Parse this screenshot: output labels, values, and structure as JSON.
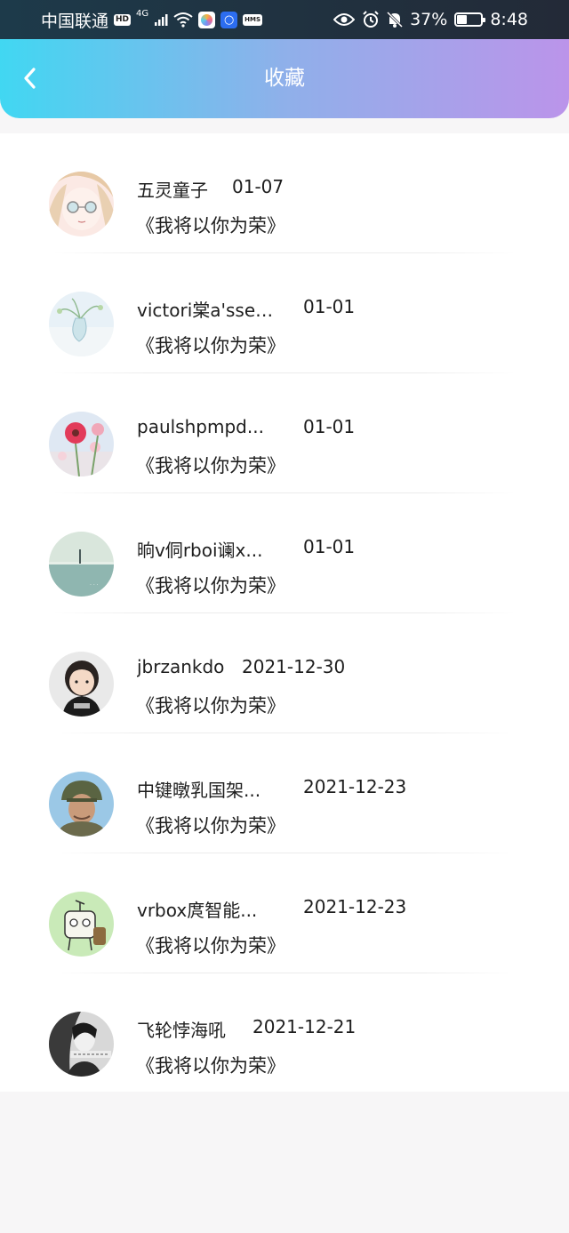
{
  "status_bar": {
    "carrier": "中国联通",
    "hd_tag": "HD",
    "network": "4G",
    "hms_tag": "HMS",
    "battery": "37%",
    "time": "8:48"
  },
  "header": {
    "title": "收藏",
    "back_icon": "chevron-left-icon"
  },
  "favorites": [
    {
      "name": "五灵童子",
      "date": "01-07",
      "book": "《我将以你为荣》",
      "avatar": "anime-girl"
    },
    {
      "name": "victori棠a'ssec...",
      "date": "01-01",
      "book": "《我将以你为荣》",
      "avatar": "glass-vase"
    },
    {
      "name": "paulshpmpd...",
      "date": "01-01",
      "book": "《我将以你为荣》",
      "avatar": "pink-flowers"
    },
    {
      "name": "晌v侗rboi谰x...",
      "date": "01-01",
      "book": "《我将以你为荣》",
      "avatar": "seaside"
    },
    {
      "name": "jbrzankdo",
      "date": "2021-12-30",
      "book": "《我将以你为荣》",
      "avatar": "child"
    },
    {
      "name": "中键暾乳国架...",
      "date": "2021-12-23",
      "book": "《我将以你为荣》",
      "avatar": "soldier"
    },
    {
      "name": "vrbox庹智能...",
      "date": "2021-12-23",
      "book": "《我将以你为荣》",
      "avatar": "cartoon-robot"
    },
    {
      "name": "飞轮悖海吼",
      "date": "2021-12-21",
      "book": "《我将以你为荣》",
      "avatar": "bw-portrait"
    }
  ]
}
